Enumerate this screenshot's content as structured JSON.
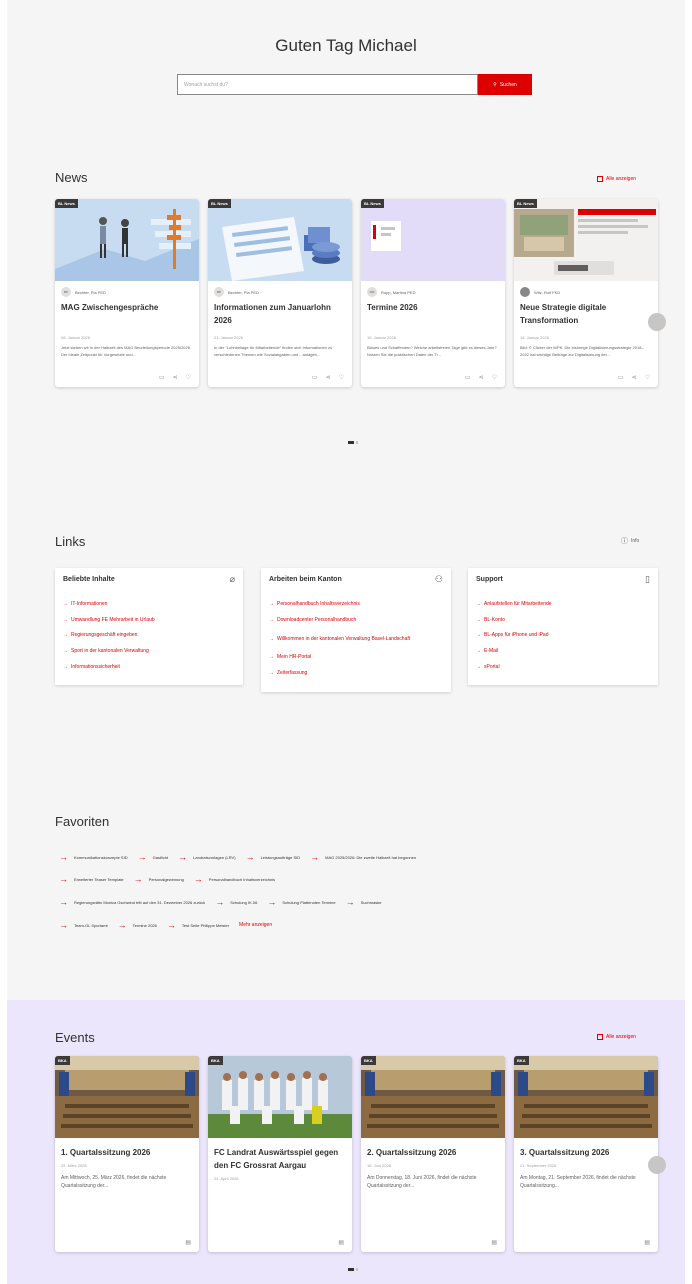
{
  "greeting": "Guten Tag Michael",
  "search": {
    "placeholder": "Wonach suchst du?",
    "button_label": "Suchen"
  },
  "news": {
    "title": "News",
    "show_all": "Alle anzeigen",
    "cards": [
      {
        "badge": "BL News",
        "author_initials": "BP",
        "author": "Bechter, Pia PED",
        "title": "MAG Zwischengespräche",
        "date": "08. Januar 2026",
        "desc": "Jetzt stehen wir in der Halbzeit des MAG Beurteilungsperiode 2025/2026. Der ideale Zeitpunkt für Vorgesetzte und..."
      },
      {
        "badge": "BL News",
        "author_initials": "BP",
        "author": "Bechter, Pia PED",
        "title": "Informationen zum Januarlohn 2026",
        "date": "21. Januar 2026",
        "desc": "In der \"Lohnbeilage für Mitarbeitende\" finden sich Informationen zu verschiedenen Themen wie Sozialabgaben und ...anlagen..."
      },
      {
        "badge": "BL News",
        "author_initials": "RM",
        "author": "Rupp, Martina PED",
        "title": "Termine 2026",
        "date": "19. Januar 2026",
        "desc": "Blaues und Schaffenden? Welche arbeitsfreien Tage gibt es dieses Jahr? Nutzen Sie die praktischen Daten der Tr..."
      },
      {
        "badge": "BL News",
        "author_initials": "",
        "author": "Witz, Rolf FKD",
        "title": "Neue Strategie digitale Transformation",
        "date": "15. Januar 2026",
        "desc": "Bild: © Clicker der WPK. Die bisherige Digitalisierungsstrategie 2018–2022 hat wichtige Beiträge zur Digitalisierung der..."
      }
    ]
  },
  "links": {
    "title": "Links",
    "info": "Info",
    "columns": [
      {
        "title": "Beliebte Inhalte",
        "icon": "pin-icon",
        "items": [
          "IT-Informationen",
          "Umwandlung FE Mehrarbeit in Urlaub",
          "Regierungsgeschäft eingeben",
          "Sport in der kantonalen Verwaltung",
          "Informationssicherheit"
        ]
      },
      {
        "title": "Arbeiten beim Kanton",
        "icon": "person-icon",
        "items": [
          "Personalhandbuch Inhaltsverzeichnis",
          "Downloadcenter Personalhandbuch",
          "Willkommen in der kantonalen Verwaltung Basel-Landschaft",
          "Mein HR-Portal",
          "Zeiterfassung"
        ]
      },
      {
        "title": "Support",
        "icon": "document-icon",
        "items": [
          "Anlaufstellen für Mitarbeitende",
          "BL-Konto",
          "BL-Apps für iPhone und iPad",
          "E-Mail",
          "sPortal"
        ]
      }
    ]
  },
  "favorites": {
    "title": "Favoriten",
    "rows": [
      [
        "Kommunikationskonzepte SID",
        "Gastlicht",
        "Landratsvorlagen (LRV)",
        "Leistungsaufträge SID",
        "MAG 2025/2026: Die zweite Halbzeit hat begonnen"
      ],
      [
        "Erweiterter Teaser Template",
        "Personalgewinnung",
        "Personalhandbuch Inhaltsverzeichnis"
      ],
      [
        "Regierungsrätin Monica Gschwind tritt auf den 31. Dezember 2026 zurück",
        "Schulung IK.06",
        "Schulung Plattenoten Termine",
        "Suchmaske"
      ],
      [
        "Team-GL Sportamt",
        "Termine 2026",
        "Test Seite Philippe Meister"
      ]
    ],
    "more": "Mehr anzeigen"
  },
  "events": {
    "title": "Events",
    "show_all": "Alle anzeigen",
    "cards": [
      {
        "badge": "BKA",
        "title": "1. Quartalssitzung 2026",
        "date": "25. März 2026",
        "desc": "Am Mittwoch, 25. März 2026, findet die nächste Quartalssitzung der..."
      },
      {
        "badge": "BKA",
        "title": "FC Landrat Auswärtsspiel gegen den FC Grossrat Aargau",
        "date": "24. April 2026",
        "desc": ""
      },
      {
        "badge": "BKA",
        "title": "2. Quartalssitzung 2026",
        "date": "18. Juni 2026",
        "desc": "Am Donnerstag, 18. Juni 2026, findet die nächste Quartalssitzung der..."
      },
      {
        "badge": "BKA",
        "title": "3. Quartalssitzung 2026",
        "date": "21. September 2026",
        "desc": "Am Montag, 21. September 2026, findet die nächste Quartalssitzung..."
      }
    ]
  },
  "colors": {
    "accent": "#dc0000",
    "events_bg": "#ebe6fc",
    "page_bg": "#f5f5f5"
  }
}
